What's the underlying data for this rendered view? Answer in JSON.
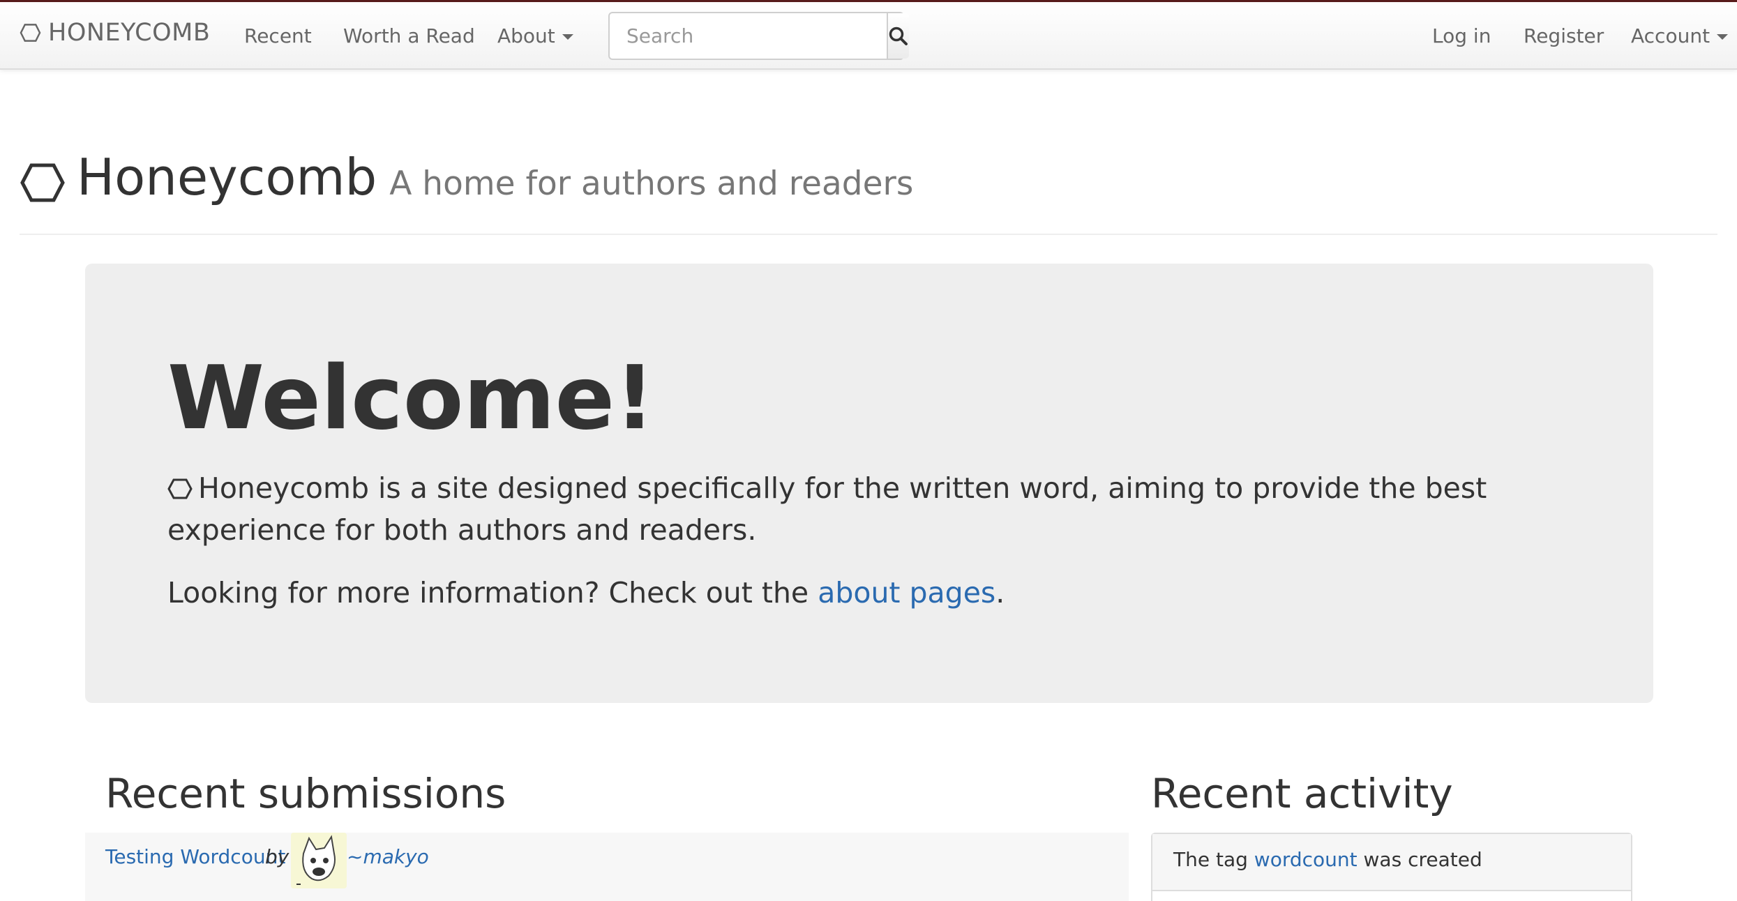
{
  "navbar": {
    "brand": "HONEYCOMB",
    "links": [
      "Recent",
      "Worth a Read",
      "About"
    ],
    "search_placeholder": "Search",
    "right_links": [
      "Log in",
      "Register",
      "Account"
    ]
  },
  "header": {
    "title": "Honeycomb",
    "subtitle": "A home for authors and readers"
  },
  "jumbotron": {
    "heading": "Welcome!",
    "lead": "Honeycomb is a site designed specifically for the written word, aiming to provide the best experience for both authors and readers.",
    "info_prefix": "Looking for more information? Check out the ",
    "info_link": "about pages",
    "info_suffix": "."
  },
  "recent_submissions": {
    "title": "Recent submissions",
    "items": [
      {
        "title": "Testing Wordcount",
        "by": "by",
        "author": "~makyo"
      }
    ]
  },
  "recent_activity": {
    "title": "Recent activity",
    "items": [
      {
        "prefix": "The tag ",
        "link": "wordcount",
        "suffix": " was created"
      }
    ]
  },
  "colors": {
    "link": "#2a6ab0",
    "jumbotron_bg": "#eeeeee",
    "accent": "#5a1d1d"
  }
}
